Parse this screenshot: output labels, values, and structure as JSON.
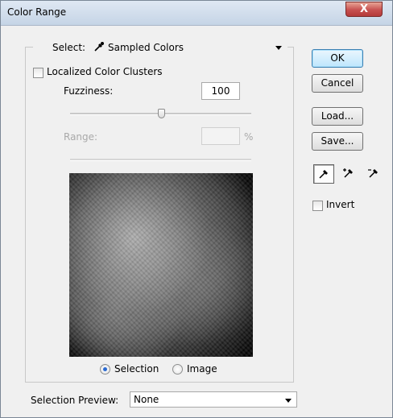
{
  "window": {
    "title": "Color Range",
    "close_glyph": "X"
  },
  "select": {
    "label": "Select:",
    "value": "Sampled Colors",
    "icon": "eyedropper-icon"
  },
  "localized": {
    "label": "Localized Color Clusters",
    "checked": false
  },
  "fuzziness": {
    "label": "Fuzziness:",
    "value": "100",
    "slider_fraction": 0.5
  },
  "range": {
    "label": "Range:",
    "value": "",
    "unit": "%",
    "enabled": false
  },
  "view": {
    "selection_label": "Selection",
    "image_label": "Image",
    "selected": "Selection"
  },
  "preview_select": {
    "label": "Selection Preview:",
    "value": "None"
  },
  "buttons": {
    "ok": "OK",
    "cancel": "Cancel",
    "load": "Load...",
    "save": "Save..."
  },
  "tools": [
    "eyedropper-icon",
    "add-to-sample-icon",
    "subtract-from-sample-icon"
  ],
  "invert": {
    "label": "Invert",
    "checked": false
  }
}
